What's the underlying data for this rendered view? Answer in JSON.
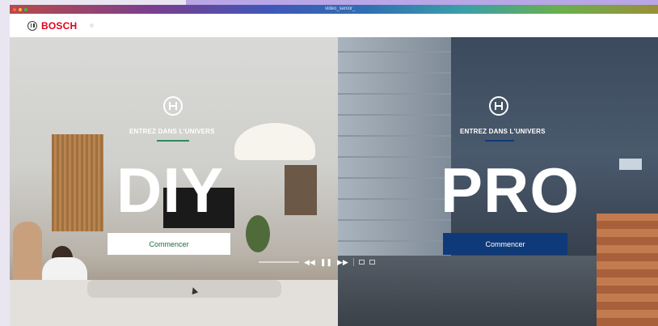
{
  "window": {
    "title": "video_senior_"
  },
  "header": {
    "brand": "BOSCH"
  },
  "diy": {
    "kicker": "ENTREZ DANS L'UNIVERS",
    "word": "DIY",
    "cta": "Commencer",
    "accent": "#2e8b57"
  },
  "pro": {
    "kicker": "ENTREZ DANS L'UNIVERS",
    "word": "PRO",
    "cta": "Commencer",
    "accent": "#0f3a7a"
  },
  "video_controls": {
    "rewind_icon": "rewind-icon",
    "pause_icon": "pause-icon",
    "forward_icon": "fast-forward-icon"
  },
  "colors": {
    "brand_red": "#e2001a",
    "diy_button_text": "#1f6b46",
    "pro_button": "#0f3a7a"
  }
}
